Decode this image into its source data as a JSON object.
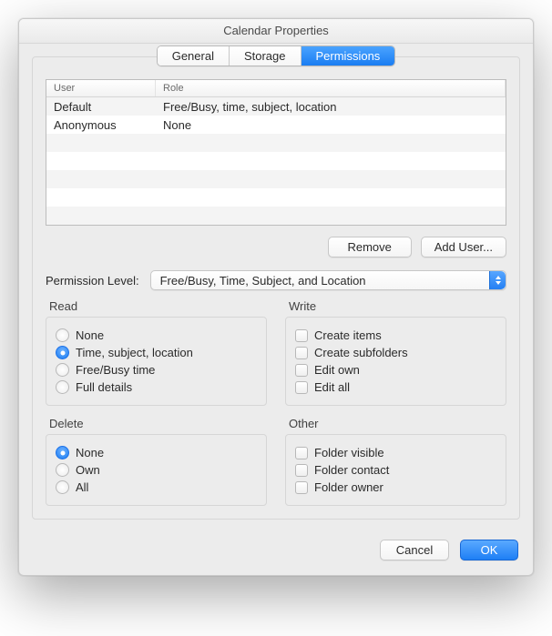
{
  "window": {
    "title": "Calendar Properties"
  },
  "tabs": [
    {
      "label": "General",
      "active": false
    },
    {
      "label": "Storage",
      "active": false
    },
    {
      "label": "Permissions",
      "active": true
    }
  ],
  "table": {
    "headers": {
      "user": "User",
      "role": "Role"
    },
    "rows": [
      {
        "user": "Default",
        "role": "Free/Busy, time, subject, location"
      },
      {
        "user": "Anonymous",
        "role": "None"
      }
    ]
  },
  "buttons": {
    "remove": "Remove",
    "add_user": "Add User...",
    "cancel": "Cancel",
    "ok": "OK"
  },
  "permission": {
    "label": "Permission Level:",
    "selected": "Free/Busy, Time, Subject, and Location"
  },
  "groups": {
    "read": {
      "title": "Read",
      "options": [
        "None",
        "Time, subject, location",
        "Free/Busy time",
        "Full details"
      ],
      "selected": 1
    },
    "write": {
      "title": "Write",
      "options": [
        "Create items",
        "Create subfolders",
        "Edit own",
        "Edit all"
      ]
    },
    "delete": {
      "title": "Delete",
      "options": [
        "None",
        "Own",
        "All"
      ],
      "selected": 0
    },
    "other": {
      "title": "Other",
      "options": [
        "Folder visible",
        "Folder contact",
        "Folder owner"
      ]
    }
  }
}
